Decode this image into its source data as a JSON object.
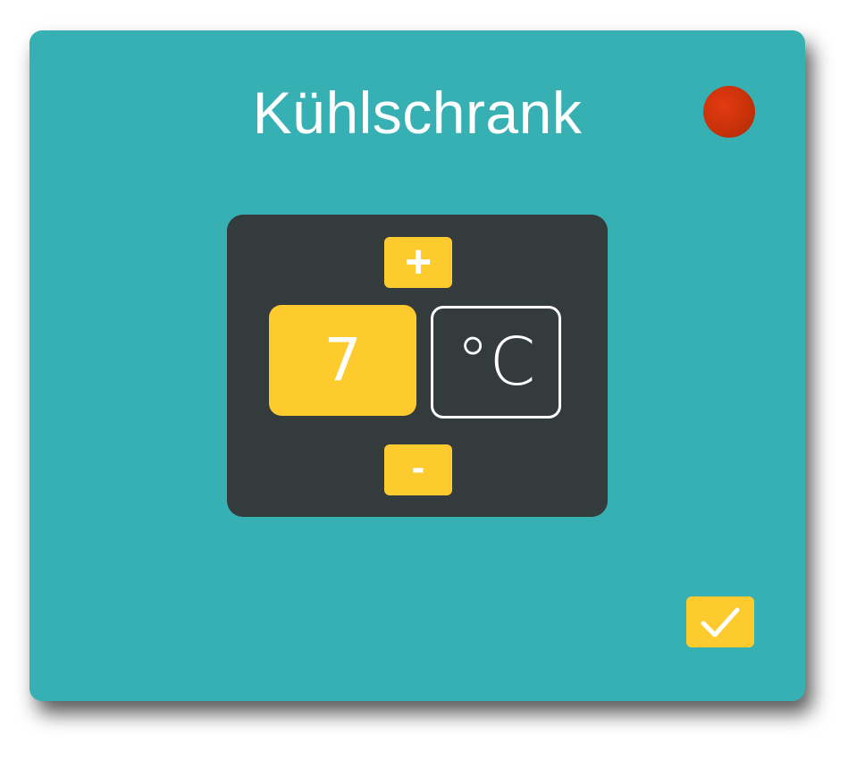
{
  "window": {
    "title": "Kühlschrank"
  },
  "status": {
    "indicator_color": "#c83209"
  },
  "thermostat": {
    "increase_label": "+",
    "decrease_label": "-",
    "value": "7",
    "unit": "°C"
  },
  "confirm": {
    "icon": "checkmark-icon"
  },
  "colors": {
    "card_background": "#36b0b3",
    "panel_background": "#343b3d",
    "accent": "#fecb2f",
    "text": "#ffffff"
  }
}
